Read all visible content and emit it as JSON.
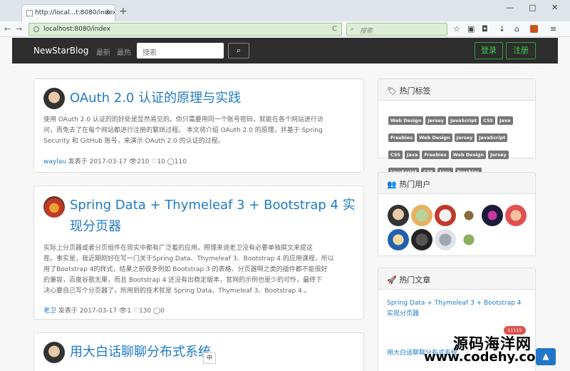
{
  "browser": {
    "tab_title": "http://local...t:8080/index",
    "tab_close": "×",
    "new_tab": "+",
    "url": "localhost:8080/index",
    "search_placeholder": "搜索",
    "minimize": "—",
    "maximize": "□",
    "close": "✕",
    "back": "←",
    "forward": "→",
    "reload": "C"
  },
  "site": {
    "brand": "NewStarBlog",
    "nav_latest": "最新",
    "nav_hot": "最热",
    "search_placeholder": "搜索",
    "search_button": "⌕",
    "login": "登录",
    "register": "注册"
  },
  "posts": [
    {
      "title": "OAuth 2.0 认证的原理与实践",
      "desc_lines": [
        "使用 OAuth 2.0 认证的的好处是显然易见的。你只需要用同一个账号密码，就能在各个网站进行访",
        "问，而免去了在每个网站都进行注册的繁琐过程。 本文将介绍 OAuth 2.0 的原理，并基于 Spring",
        "Security 和 GitHub 账号，来演示 OAuth 2.0 的认证的过程。"
      ],
      "author": "waylau",
      "meta": "发表于 2017-03-17 👁210 ♡10 ◯110"
    },
    {
      "title_line1": "Spring Data + Thymeleaf 3 + Bootstrap 4 实",
      "title_line2": "现分页器",
      "desc_lines": [
        "实际上分页器或者分页组件在现实中都有广泛着的应用，照理来说老卫没有必要单独撰文来提这",
        "茬。事实是，我近期刚好在写一门关于Spring Data、Thymeleaf 3、Bootstrap 4 的应用课程，所以",
        "用了Bootstrap 4的样式，结果之前很多例如 Bootstrap 3 的表格、分页器啊之类的插件都不能很好",
        "的兼容，百度谷歌无果，而且 Bootstrap 4 还没有出稳定版本，官网的示例也是少的可怜，最终下",
        "决心要自己写个分页器了，所用到的技术就是 Spring Data、Thymeleaf 3、Bootstrap 4 。"
      ],
      "author": "老卫",
      "meta": "发表于 2017-03-17 👁1 ♡130 ◯0"
    },
    {
      "title": "用大白话聊聊分布式系统"
    }
  ],
  "sidebar": {
    "tags_title": "热门标签",
    "tags": [
      "Web Design",
      "Jersey",
      "JavaScript",
      "CSS",
      "Java",
      "Freebies",
      "Web Design",
      "Jersey",
      "JavaScript",
      "CSS",
      "Java",
      "Freebies",
      "Web Design",
      "Jersey",
      "JavaScript",
      "CSS",
      "Java",
      "Freebies"
    ],
    "users_title": "热门用户",
    "articles_title": "热门文章",
    "article1_line1": "Spring Data + Thymeleaf 3 + Bootstrap 4",
    "article1_line2": "实现分页器",
    "article1_badge": "11115",
    "article2": "用大白话聊聊分布式系统"
  },
  "overlay": {
    "watermark_cn": "源码海洋网",
    "watermark_url": "www.codehy.com",
    "ime": "中",
    "scroll_top": "▲"
  },
  "colors": {
    "accent": "#1f7bc5",
    "header_bg": "#2d2d2d",
    "success": "#3fcf4f",
    "badge": "#d9534f"
  }
}
